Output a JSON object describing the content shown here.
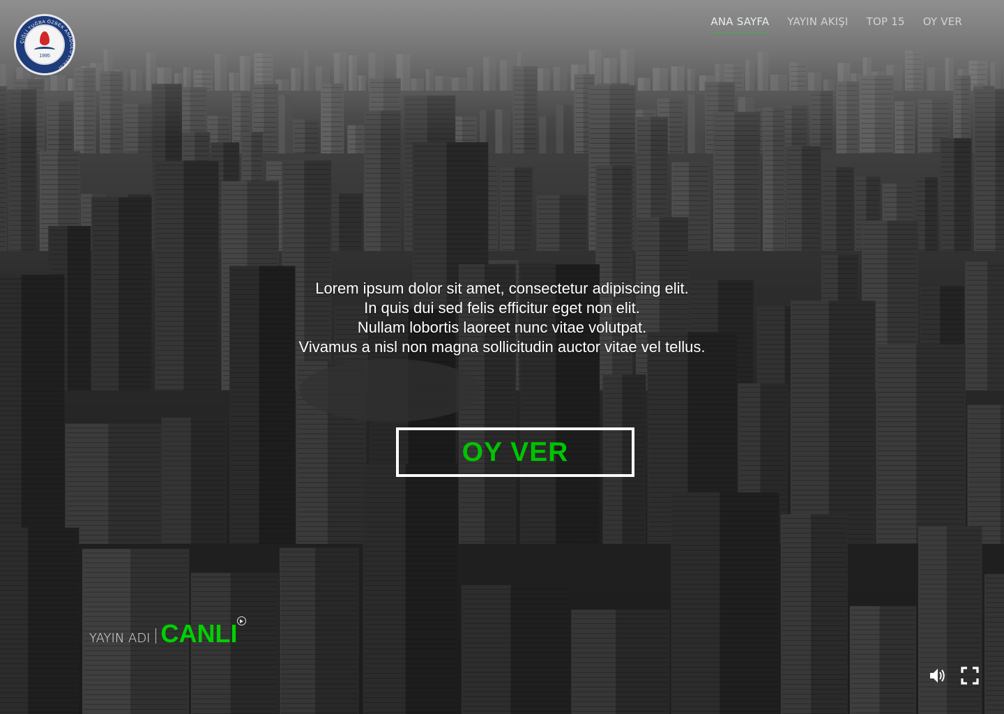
{
  "logo": {
    "ring_text": "ÇİĞLİ TUĞBA ÖZBEK ANADOLU LİSESİ",
    "year": "1995",
    "icon": "school-emblem-icon"
  },
  "nav": {
    "items": [
      {
        "label": "ANA SAYFA",
        "active": true
      },
      {
        "label": "YAYIN AKIŞI",
        "active": false
      },
      {
        "label": "TOP 15",
        "active": false
      },
      {
        "label": "OY VER",
        "active": false
      }
    ],
    "active_underline_color": "#39b54a"
  },
  "hero": {
    "lines": [
      "Lorem ipsum dolor sit amet, consectetur adipiscing elit.",
      "In quis dui sed felis efficitur eget non elit.",
      "Nullam lobortis laoreet nunc vitae volutpat.",
      "Vivamus a nisl non magna sollicitudin auctor vitae vel tellus."
    ]
  },
  "vote_button": {
    "label": "OY VER",
    "text_color": "#00c400"
  },
  "live": {
    "broadcast_name": "YAYIN ADI",
    "status": "CANLI",
    "status_color": "#00d000",
    "indicator_icon": "play-circle-icon"
  },
  "controls": {
    "volume_icon": "volume-icon",
    "fullscreen_icon": "fullscreen-icon"
  }
}
